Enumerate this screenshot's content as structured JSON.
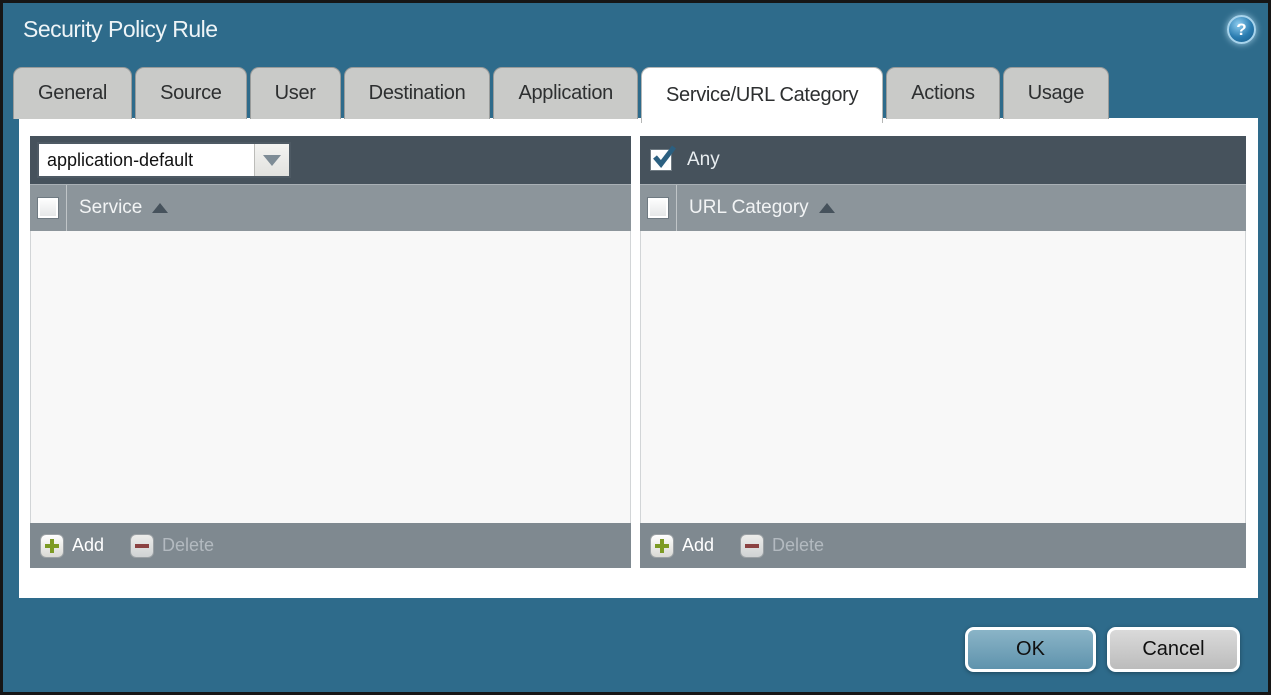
{
  "window": {
    "title": "Security Policy Rule",
    "help_glyph": "?",
    "ok_label": "OK",
    "cancel_label": "Cancel"
  },
  "tabs": [
    {
      "label": "General",
      "active": false
    },
    {
      "label": "Source",
      "active": false
    },
    {
      "label": "User",
      "active": false
    },
    {
      "label": "Destination",
      "active": false
    },
    {
      "label": "Application",
      "active": false
    },
    {
      "label": "Service/URL Category",
      "active": true
    },
    {
      "label": "Actions",
      "active": false
    },
    {
      "label": "Usage",
      "active": false
    }
  ],
  "service_panel": {
    "service_type_value": "application-default",
    "column_header": "Service",
    "sort_direction": "ascending",
    "select_all_checked": false,
    "rows": [],
    "add_label": "Add",
    "delete_label": "Delete",
    "delete_enabled": false
  },
  "url_category_panel": {
    "any_label": "Any",
    "any_checked": true,
    "column_header": "URL Category",
    "sort_direction": "ascending",
    "select_all_checked": false,
    "rows": [],
    "add_label": "Add",
    "delete_label": "Delete",
    "delete_enabled": false
  },
  "colors": {
    "background_teal": "#2e6b8b",
    "panel_header_dark": "#46525c",
    "column_header_gray": "#8c959b",
    "footer_gray": "#7f8990",
    "tab_inactive": "#c9cac8",
    "tab_active": "#ffffff",
    "ok_button": "#6fa0b8",
    "cancel_button": "#c9c9c9",
    "add_plus_green": "#7d9b25",
    "delete_minus_red": "#8b4242",
    "checkmark_blue": "#2b5f80"
  }
}
